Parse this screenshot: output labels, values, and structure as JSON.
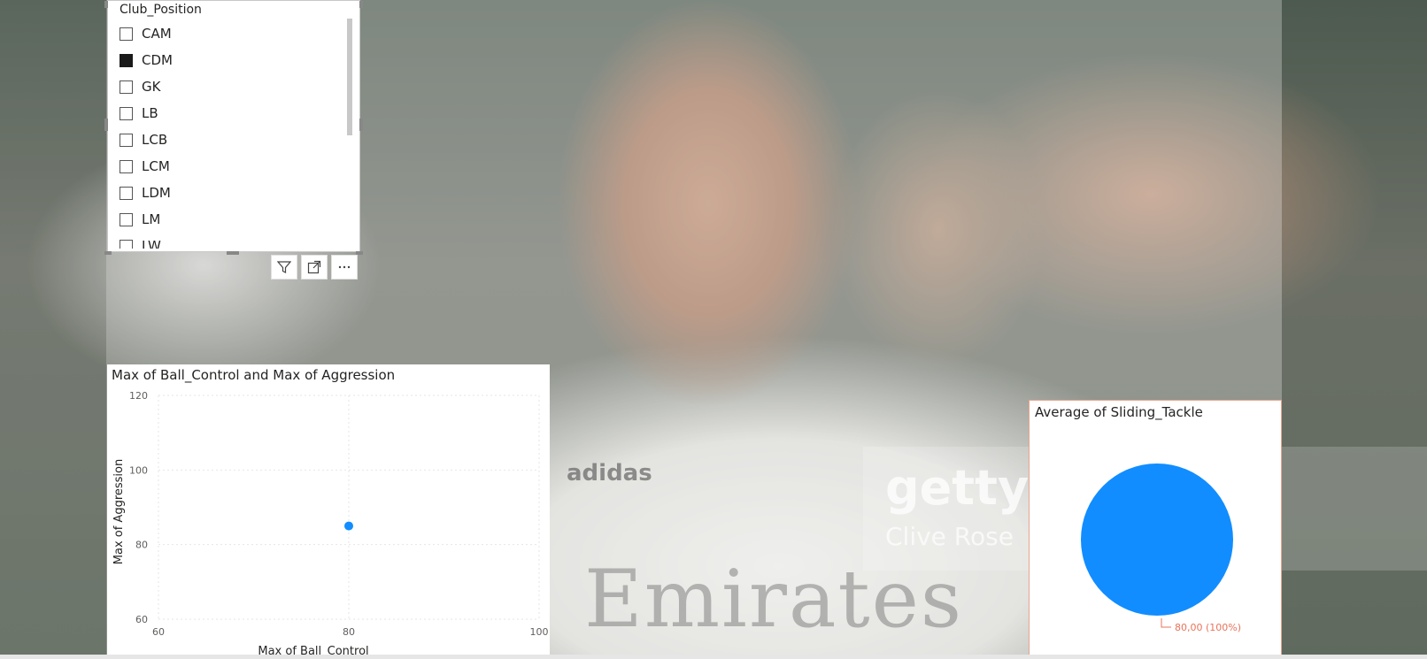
{
  "slicer": {
    "title": "Club_Position",
    "items": [
      {
        "label": "CAM",
        "checked": false
      },
      {
        "label": "CDM",
        "checked": true
      },
      {
        "label": "GK",
        "checked": false
      },
      {
        "label": "LB",
        "checked": false
      },
      {
        "label": "LCB",
        "checked": false
      },
      {
        "label": "LCM",
        "checked": false
      },
      {
        "label": "LDM",
        "checked": false
      },
      {
        "label": "LM",
        "checked": false
      },
      {
        "label": "LW",
        "checked": false
      }
    ]
  },
  "background": {
    "watermark_text": "gettyi",
    "watermark_sub": "Clive Rose",
    "jersey_text": "Emirates",
    "brand_text": "adidas"
  },
  "scatter_chart": {
    "chart_data": {
      "type": "scatter",
      "title": "Max of Ball_Control and Max of Aggression",
      "xlabel": "Max of Ball_Control",
      "ylabel": "Max of Aggression",
      "xlim": [
        60,
        100
      ],
      "ylim": [
        60,
        120
      ],
      "xticks": [
        60,
        80,
        100
      ],
      "yticks": [
        60,
        80,
        100,
        120
      ],
      "points": [
        {
          "x": 80,
          "y": 85
        }
      ],
      "grid": true,
      "color": "#118dff"
    }
  },
  "pie_chart": {
    "chart_data": {
      "type": "pie",
      "title": "Average of Sliding_Tackle",
      "values": [
        80
      ],
      "data_labels": [
        "80,00 (100%)"
      ],
      "color": "#118dff",
      "label_color": "#e8735a"
    }
  }
}
